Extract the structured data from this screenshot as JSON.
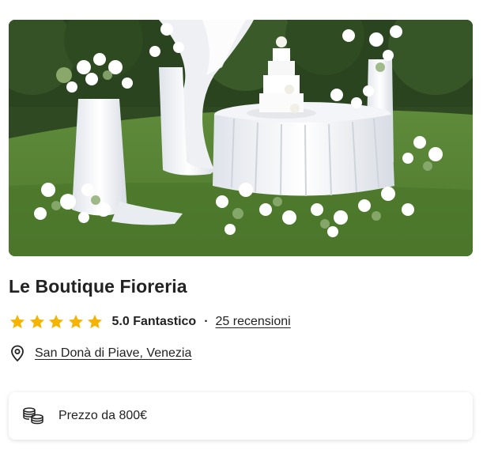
{
  "vendor": {
    "name": "Le Boutique Fioreria",
    "rating": {
      "stars": 5,
      "max_stars": 5,
      "score_label": "5.0 Fantastico",
      "separator": "·",
      "reviews_label": "25 recensioni"
    },
    "location": "San Donà di Piave, Venezia",
    "price": "Prezzo da 800€"
  },
  "colors": {
    "star": "#f5b400",
    "text": "#222222"
  },
  "icons": {
    "rating": "star-icon",
    "location": "map-pin-icon",
    "price": "coins-icon"
  }
}
